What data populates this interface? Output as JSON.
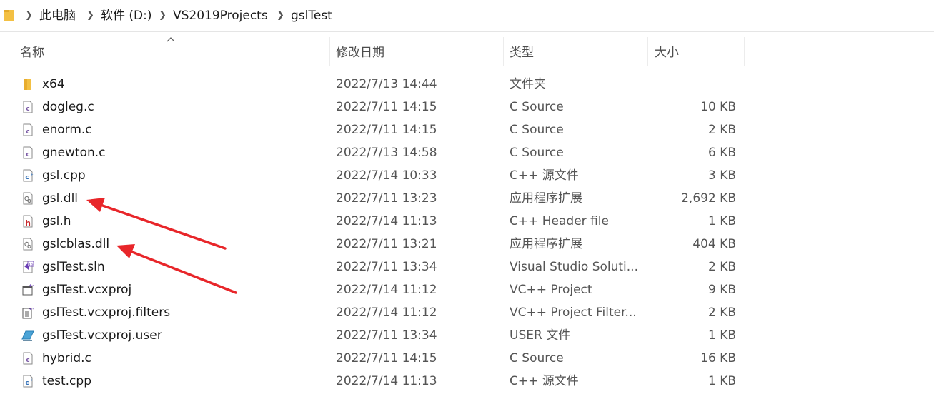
{
  "breadcrumb": [
    "此电脑",
    "软件 (D:)",
    "VS2019Projects",
    "gslTest"
  ],
  "columns": {
    "name": "名称",
    "date": "修改日期",
    "type": "类型",
    "size": "大小"
  },
  "files": [
    {
      "name": "x64",
      "date": "2022/7/13 14:44",
      "type": "文件夹",
      "size": "",
      "icon": "folder-icon"
    },
    {
      "name": "dogleg.c",
      "date": "2022/7/11 14:15",
      "type": "C Source",
      "size": "10 KB",
      "icon": "c-source-file-icon"
    },
    {
      "name": "enorm.c",
      "date": "2022/7/11 14:15",
      "type": "C Source",
      "size": "2 KB",
      "icon": "c-source-file-icon"
    },
    {
      "name": "gnewton.c",
      "date": "2022/7/13 14:58",
      "type": "C Source",
      "size": "6 KB",
      "icon": "c-source-file-icon"
    },
    {
      "name": "gsl.cpp",
      "date": "2022/7/14 10:33",
      "type": "C++ 源文件",
      "size": "3 KB",
      "icon": "cpp-source-file-icon"
    },
    {
      "name": "gsl.dll",
      "date": "2022/7/11 13:23",
      "type": "应用程序扩展",
      "size": "2,692 KB",
      "icon": "dll-file-icon"
    },
    {
      "name": "gsl.h",
      "date": "2022/7/14 11:13",
      "type": "C++ Header file",
      "size": "1 KB",
      "icon": "header-file-icon"
    },
    {
      "name": "gslcblas.dll",
      "date": "2022/7/11 13:21",
      "type": "应用程序扩展",
      "size": "404 KB",
      "icon": "dll-file-icon"
    },
    {
      "name": "gslTest.sln",
      "date": "2022/7/11 13:34",
      "type": "Visual Studio Soluti...",
      "size": "2 KB",
      "icon": "vs-solution-icon"
    },
    {
      "name": "gslTest.vcxproj",
      "date": "2022/7/14 11:12",
      "type": "VC++ Project",
      "size": "9 KB",
      "icon": "vcxproj-file-icon"
    },
    {
      "name": "gslTest.vcxproj.filters",
      "date": "2022/7/14 11:12",
      "type": "VC++ Project Filter...",
      "size": "2 KB",
      "icon": "vcxproj-filters-icon"
    },
    {
      "name": "gslTest.vcxproj.user",
      "date": "2022/7/11 13:34",
      "type": "USER 文件",
      "size": "1 KB",
      "icon": "user-file-icon"
    },
    {
      "name": "hybrid.c",
      "date": "2022/7/11 14:15",
      "type": "C Source",
      "size": "16 KB",
      "icon": "c-source-file-icon"
    },
    {
      "name": "test.cpp",
      "date": "2022/7/14 11:13",
      "type": "C++ 源文件",
      "size": "1 KB",
      "icon": "cpp-source-file-icon"
    }
  ],
  "colors": {
    "annotation_arrow": "#e8262a",
    "c_icon": "#7b5aa6",
    "cpp_icon": "#2f6db5",
    "header_icon": "#c8262a",
    "vs_icon": "#6b3fb5"
  }
}
